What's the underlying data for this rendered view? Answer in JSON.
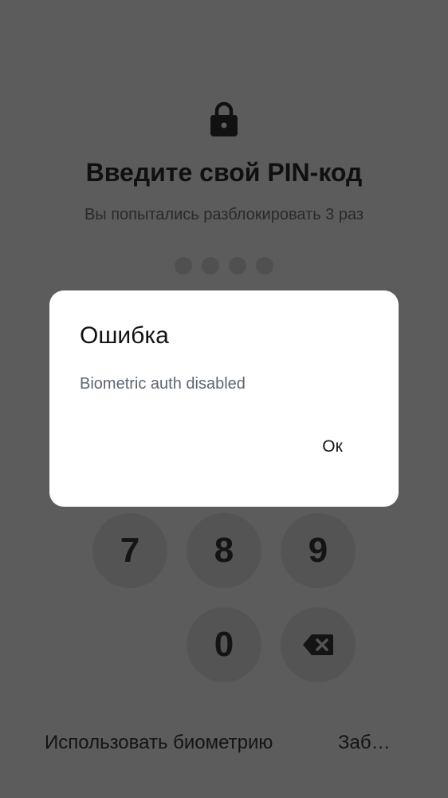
{
  "pin_screen": {
    "title": "Введите свой PIN-код",
    "subtitle": "Вы попытались разблокировать 3 раз",
    "pin_length": 4,
    "keypad": {
      "key_7": "7",
      "key_8": "8",
      "key_9": "9",
      "key_0": "0",
      "delete_icon": "backspace-icon"
    },
    "use_biometrics_label": "Использовать биометрию",
    "forgot_label": "Заб…"
  },
  "dialog": {
    "title": "Ошибка",
    "message": "Biometric auth disabled",
    "ok_label": "Ок"
  },
  "colors": {
    "scrim_background": "#5c5c5c",
    "dialog_background": "#ffffff",
    "dialog_message_text": "#5e6670"
  }
}
